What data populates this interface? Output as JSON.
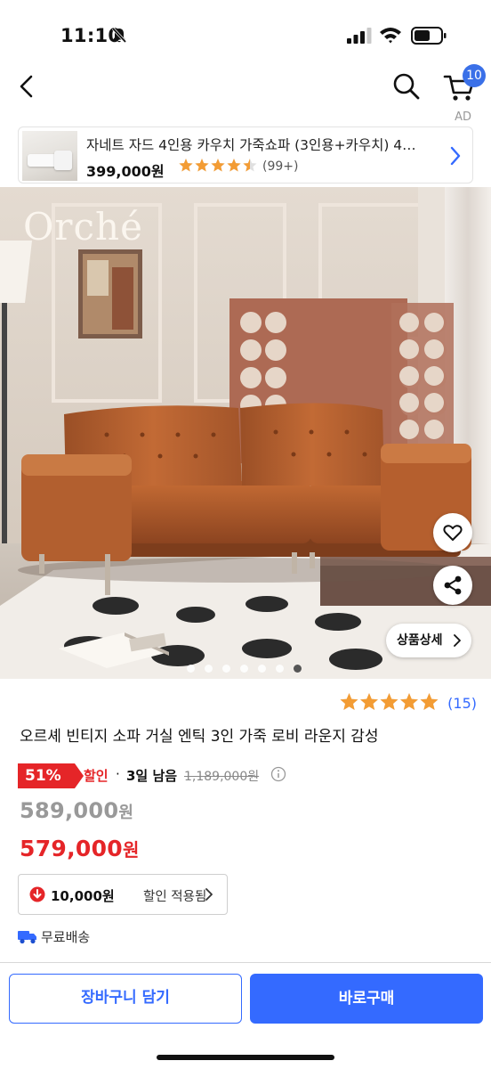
{
  "status_bar": {
    "time": "11:10"
  },
  "nav": {
    "cart_count": "10",
    "ad_label": "AD"
  },
  "ad_banner": {
    "title": "자네트 자드 4인용 카우치 가죽쇼파 (3인용+카우치) 4…",
    "price": "399,000원",
    "rating": 4.5,
    "review_count": "(99+)"
  },
  "hero": {
    "brand_text": "Orché",
    "detail_button": "상품상세",
    "page_dots": 7,
    "active_dot": 6
  },
  "product": {
    "rating": 5,
    "review_count": "(15)",
    "title": "오르셰 빈티지 소파 거실 엔틱 3인 가죽 로비 라운지 감성",
    "discount_rate": "51%",
    "discount_label": "할인",
    "separator": "·",
    "remaining": "3일 남음",
    "original_price": "1,189,000원",
    "base_price_number": "589,000",
    "base_price_unit": "원",
    "sale_price_number": "579,000",
    "sale_price_unit": "원",
    "coupon_amount": "10,000원",
    "coupon_text": "할인 적용됨",
    "shipping": "무료배송"
  },
  "actions": {
    "cart_button": "장바구니 담기",
    "buy_button": "바로구매"
  },
  "colors": {
    "accent": "#346aff",
    "discount": "#e52528",
    "star": "#f39c34"
  },
  "icons": [
    "bell-mute-icon",
    "signal-icon",
    "wifi-icon",
    "battery-icon",
    "back-icon",
    "search-icon",
    "cart-icon",
    "chevron-right-icon",
    "heart-icon",
    "share-icon",
    "info-icon",
    "coupon-down-icon",
    "truck-icon",
    "star-icon"
  ]
}
